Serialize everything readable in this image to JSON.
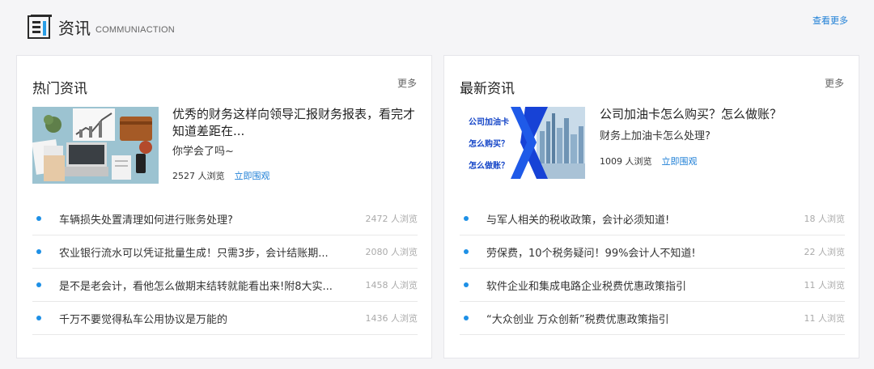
{
  "header": {
    "title": "资讯",
    "subtitle": "COMMUNIACTION",
    "see_more": "查看更多"
  },
  "hot": {
    "title": "热门资讯",
    "more": "更多",
    "featured": {
      "title": "优秀的财务这样向领导汇报财务报表，看完才知道差距在...",
      "desc": "你学会了吗~",
      "views": "2527 人浏览",
      "link": "立即围观"
    },
    "items": [
      {
        "title": "车辆损失处置清理如何进行账务处理?",
        "views": "2472 人浏览"
      },
      {
        "title": "农业银行流水可以凭证批量生成！只需3步，会计结账期...",
        "views": "2080 人浏览"
      },
      {
        "title": "是不是老会计，看他怎么做期末结转就能看出来!附8大实...",
        "views": "1458 人浏览"
      },
      {
        "title": "千万不要觉得私车公用协议是万能的",
        "views": "1436 人浏览"
      }
    ]
  },
  "latest": {
    "title": "最新资讯",
    "more": "更多",
    "featured": {
      "title": "公司加油卡怎么购买？怎么做账？",
      "desc": "财务上加油卡怎么处理?",
      "views": "1009 人浏览",
      "link": "立即围观",
      "image_lines": [
        "公司加油卡",
        "怎么购买？",
        "怎么做账？"
      ]
    },
    "items": [
      {
        "title": "与军人相关的税收政策，会计必须知道!",
        "views": "18 人浏览"
      },
      {
        "title": "劳保费，10个税务疑问！99%会计人不知道!",
        "views": "22 人浏览"
      },
      {
        "title": "软件企业和集成电路企业税费优惠政策指引",
        "views": "11 人浏览"
      },
      {
        "title": "“大众创业 万众创新”税费优惠政策指引",
        "views": "11 人浏览"
      }
    ]
  },
  "colors": {
    "accent": "#1e7fd6",
    "dot": "#1e90e6",
    "card_bg": "#ffffff",
    "page_bg": "#f5f5f7"
  }
}
